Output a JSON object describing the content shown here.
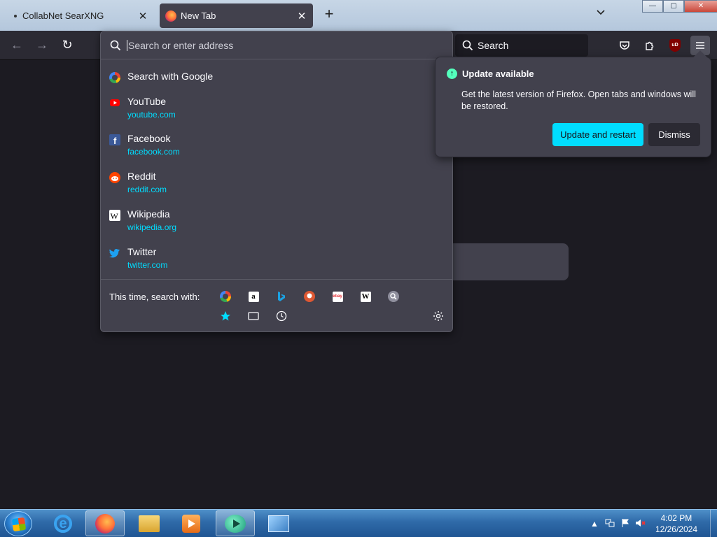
{
  "tabs": [
    {
      "title": "CollabNet SearXNG",
      "close": "✕"
    },
    {
      "title": "New Tab",
      "close": "✕"
    }
  ],
  "new_tab_symbol": "+",
  "tab_list_symbol": "⌄",
  "window_controls": {
    "minimize": "—",
    "maximize": "▢",
    "close": "✕"
  },
  "navigation": {
    "back": "←",
    "forward": "→",
    "reload": "↻"
  },
  "toolbar_search": {
    "placeholder": "Search"
  },
  "ublock_label": "uD",
  "url_panel": {
    "placeholder": "Search or enter address",
    "results": [
      {
        "title": "Search with Google",
        "url": "",
        "icon": "google-icon"
      },
      {
        "title": "YouTube",
        "url": "youtube.com",
        "icon": "youtube-icon"
      },
      {
        "title": "Facebook",
        "url": "facebook.com",
        "icon": "facebook-icon"
      },
      {
        "title": "Reddit",
        "url": "reddit.com",
        "icon": "reddit-icon"
      },
      {
        "title": "Wikipedia",
        "url": "wikipedia.org",
        "icon": "wikipedia-icon"
      },
      {
        "title": "Twitter",
        "url": "twitter.com",
        "icon": "twitter-icon"
      }
    ],
    "oneoff_label": "This time, search with:",
    "engines": [
      "google",
      "amazon",
      "bing",
      "duckduckgo",
      "ebay",
      "wikipedia",
      "searxng"
    ],
    "engine_letters": {
      "amazon": "a",
      "wikipedia": "W",
      "ebay": "ebay"
    }
  },
  "update_doorhanger": {
    "title": "Update available",
    "message": "Get the latest version of Firefox. Open tabs and windows will be restored.",
    "primary": "Update and restart",
    "secondary": "Dismiss"
  },
  "taskbar": {
    "time": "4:02 PM",
    "date": "12/26/2024",
    "tray_arrow": "▲"
  },
  "colors": {
    "accent": "#00ddff",
    "panel": "#42414d",
    "background": "#1c1b22",
    "update_icon": "#54ffbd"
  }
}
